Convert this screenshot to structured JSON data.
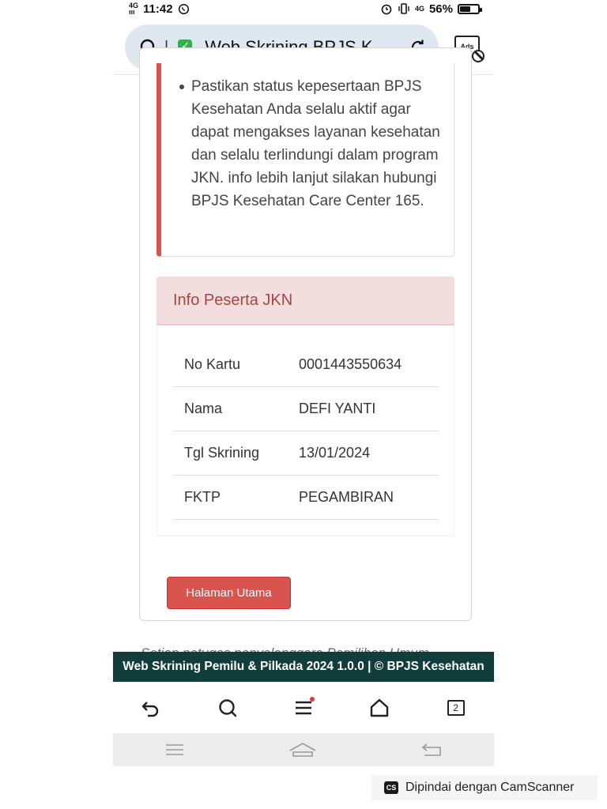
{
  "status_bar": {
    "network": "4G",
    "time": "11:42",
    "network_right": "4G",
    "battery": "56%",
    "battery_level": 0.56
  },
  "browser": {
    "page_title": "Web Skrining BPJS K...",
    "ads_label": "Ads",
    "tabs_count": "2"
  },
  "notice": {
    "items": [
      "Pastikan status kepesertaan BPJS Kesehatan Anda selalu aktif agar dapat mengakses layanan kesehatan dan selalu terlindungi dalam program JKN. info lebih lanjut silakan hubungi BPJS Kesehatan Care Center 165."
    ]
  },
  "info": {
    "title": "Info Peserta JKN",
    "rows": [
      {
        "label": "No Kartu",
        "value": "0001443550634"
      },
      {
        "label": "Nama",
        "value": "DEFI YANTI"
      },
      {
        "label": "Tgl Skrining",
        "value": "13/01/2024"
      },
      {
        "label": "FKTP",
        "value": "PEGAMBIRAN"
      }
    ]
  },
  "home_button_label": "Halaman Utama",
  "partial_text": "Setiap petugas penyelenggara Pemilihan Umum",
  "footer_text": "Web Skrining Pemilu & Pilkada 2024 1.0.0 | © BPJS Kesehatan",
  "watermark": {
    "logo": "CS",
    "text": "Dipindai dengan CamScanner"
  },
  "colors": {
    "accent_red": "#d9534f",
    "panel_header_bg": "#f2dede",
    "panel_header_text": "#a94442",
    "footer_bg": "#113d3a",
    "secure_green": "#2fb24a"
  }
}
